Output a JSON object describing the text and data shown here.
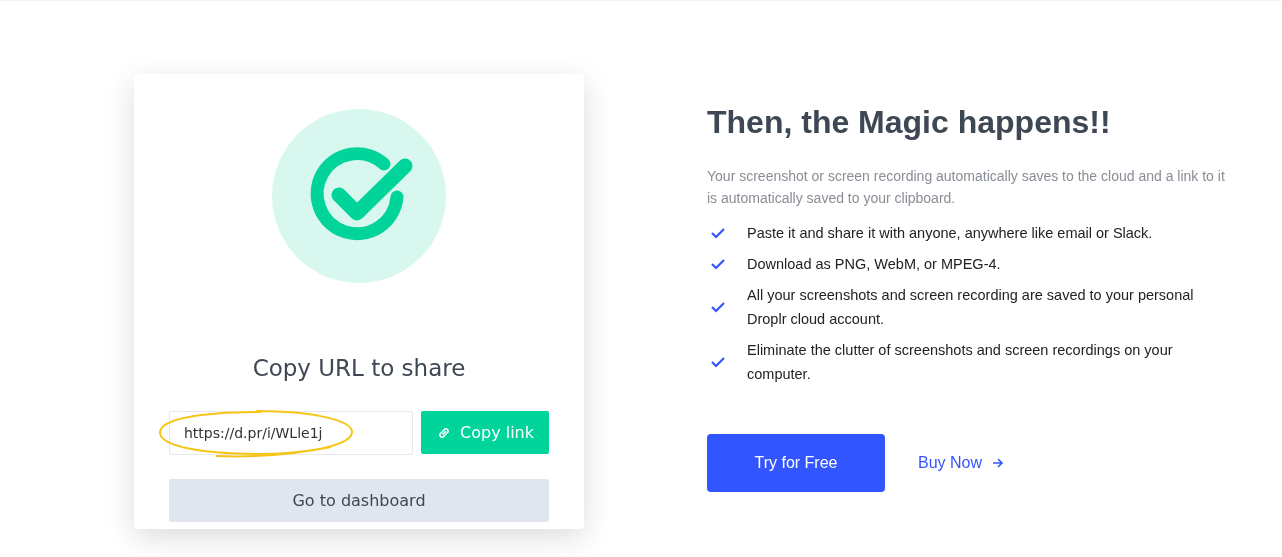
{
  "card": {
    "title": "Copy URL to share",
    "url_field": {
      "value": "https://d.pr/i/WLle1j",
      "highlighted": true
    },
    "copy_button": "Copy link",
    "dashboard_button": "Go to dashboard"
  },
  "info": {
    "heading": "Then, the Magic happens!!",
    "intro": "Your screenshot or screen recording automatically saves to the cloud and a link to it is automatically saved to your clipboard.",
    "features": [
      "Paste it and share it with anyone, anywhere like email or Slack.",
      "Download as PNG, WebM, or MPEG-4.",
      "All your screenshots and screen recording are saved to your personal Droplr cloud account.",
      "Eliminate the clutter of screenshots and screen recordings on your computer."
    ],
    "primary_button": "Try for Free",
    "secondary_link": "Buy Now"
  }
}
